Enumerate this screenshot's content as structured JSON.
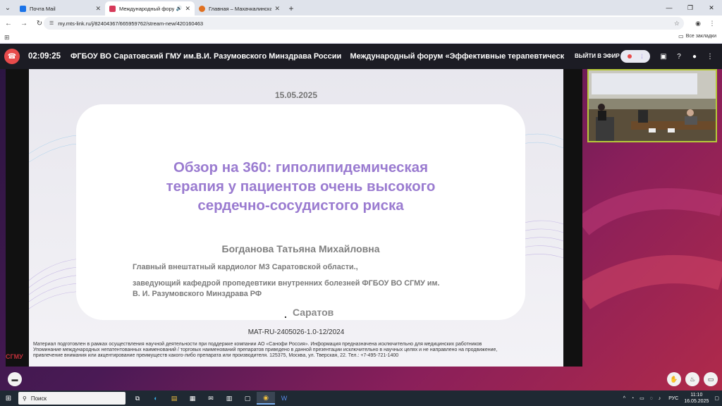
{
  "browser": {
    "tabs": [
      {
        "title": "Почта Mail",
        "color": "#1a73e8"
      },
      {
        "title": "Международный форум «",
        "color": "#d63a5a"
      },
      {
        "title": "Главная – Махачкалинская кл",
        "color": "#e07020"
      }
    ],
    "url": "my.mts-link.ru/j/82404367/665959762/stream-new/420160463",
    "bookmarks_all": "Все закладки"
  },
  "app": {
    "timer": "02:09:25",
    "title": "ФГБОУ ВО Саратовский ГМУ им.В.И. Разумовского Минздрава России    Международный форум «Эффективные терапевтические страт",
    "live_label": "ВЫЙТИ В ЭФИР"
  },
  "slide": {
    "date": "15.05.2025",
    "title_lines": [
      "Обзор на 360: гиполипидемическая",
      "терапия у пациентов очень высокого",
      "сердечно-сосудистого риска"
    ],
    "speaker": "Богданова Татьяна Михайловна",
    "role_1": "Главный внештатный кардиолог МЗ Саратовской области.,",
    "role_2": "заведующий кафедрой пропедевтики внутренних болезней ФГБОУ ВО СГМУ им.",
    "role_3": "В. И. Разумовского Минздрава РФ",
    "city_dot": ".",
    "city": "Саратов",
    "code": "MAT-RU-2405026-1.0-12/2024",
    "disclaimer_1": "Материал подготовлен в рамках осуществления научной деятельности при поддержке компании АО «Санофи Россия». Информация предназначена исключительно для медицинских работников",
    "disclaimer_2": "Упоминание международных непатентованных наименований / торговых наименований препаратов приведено в данной презентации исключительно в научных целях и не направлено на продвижение,",
    "disclaimer_3": "привлечение внимания или акцентирование преимуществ какого-либо препарата или производителя. 125375, Москва, ул. Тверская, 22. Тел.: +7-495-721-1400",
    "logo": "СГМУ"
  },
  "taskbar": {
    "search": "Поиск",
    "lang": "РУС",
    "time": "11:10",
    "date": "16.05.2025"
  }
}
